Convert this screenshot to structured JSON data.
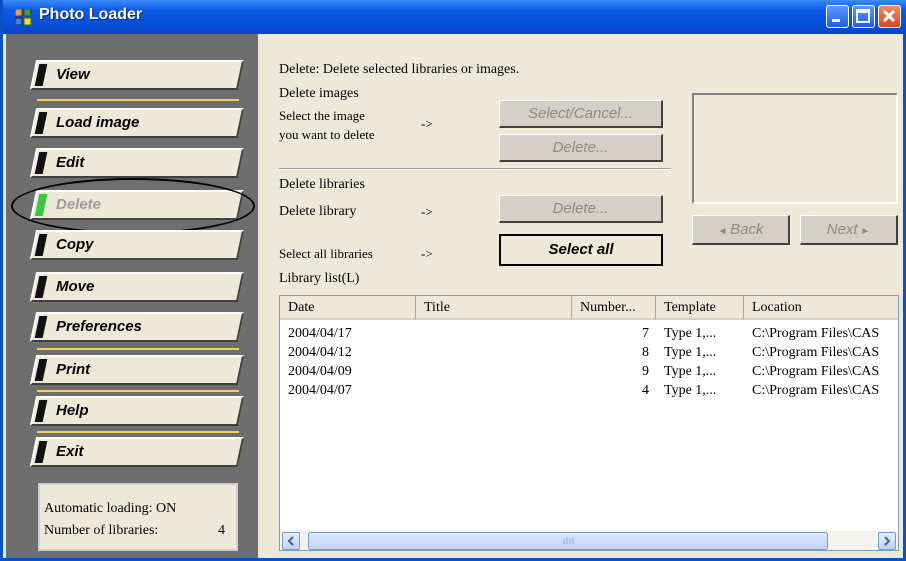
{
  "window": {
    "title": "Photo Loader"
  },
  "nav": {
    "items": [
      {
        "label": "View"
      },
      {
        "label": "Load image"
      },
      {
        "label": "Edit"
      },
      {
        "label": "Delete"
      },
      {
        "label": "Copy"
      },
      {
        "label": "Move"
      },
      {
        "label": "Preferences"
      },
      {
        "label": "Print"
      },
      {
        "label": "Help"
      },
      {
        "label": "Exit"
      }
    ],
    "active_color": "#3cc83c"
  },
  "status": {
    "auto_loading": "Automatic loading:  ON",
    "libraries_label": "Number of libraries:",
    "libraries_count": "4"
  },
  "main": {
    "description": "Delete: Delete selected libraries or images.",
    "delete_images_heading": "Delete images",
    "select_image_line1": "Select the image",
    "select_image_line2": "you want to delete",
    "arrow": "->",
    "select_cancel_label": "Select/Cancel...",
    "delete_image_label": "Delete...",
    "delete_libraries_heading": "Delete libraries",
    "delete_library_label": "Delete library",
    "delete_library_button": "Delete...",
    "select_all_label": "Select all libraries",
    "select_all_button": "Select all",
    "back_label": "Back",
    "next_label": "Next",
    "library_list_label": "Library list(L)"
  },
  "table": {
    "columns": [
      "Date",
      "Title",
      "Number...",
      "Template",
      "Location"
    ],
    "rows": [
      {
        "date": "2004/04/17",
        "title": "",
        "number": "7",
        "template": "Type 1,...",
        "location": "C:\\Program Files\\CAS"
      },
      {
        "date": "2004/04/12",
        "title": "",
        "number": "8",
        "template": "Type 1,...",
        "location": "C:\\Program Files\\CAS"
      },
      {
        "date": "2004/04/09",
        "title": "",
        "number": "9",
        "template": "Type 1,...",
        "location": "C:\\Program Files\\CAS"
      },
      {
        "date": "2004/04/07",
        "title": "",
        "number": "4",
        "template": "Type 1,...",
        "location": "C:\\Program Files\\CAS"
      }
    ]
  }
}
